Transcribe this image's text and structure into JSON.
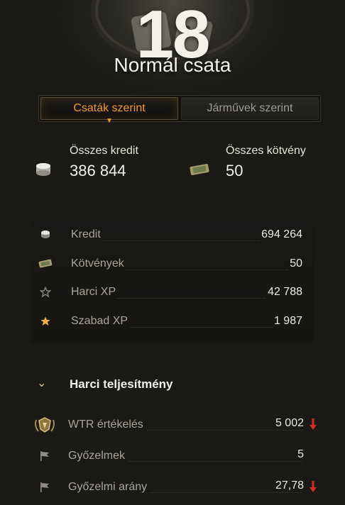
{
  "header": {
    "battles_count": "18",
    "mode_title": "Normál csata"
  },
  "tabs": [
    {
      "label": "Csaták szerint",
      "active": true
    },
    {
      "label": "Járművek szerint",
      "active": false
    }
  ],
  "summary": {
    "credits_label": "Összes kredit",
    "credits_value": "386 844",
    "bonds_label": "Összes kötvény",
    "bonds_value": "50"
  },
  "details": [
    {
      "icon": "coins-icon",
      "label": "Kredit",
      "value": "694 264"
    },
    {
      "icon": "bonds-icon",
      "label": "Kötvények",
      "value": "50"
    },
    {
      "icon": "star-outline-icon",
      "label": "Harci XP",
      "value": "42 788"
    },
    {
      "icon": "star-gold-icon",
      "label": "Szabad XP",
      "value": "1 987"
    }
  ],
  "performance": {
    "title": "Harci teljesítmény",
    "rows": [
      {
        "icon": "wtr-badge-icon",
        "label": "WTR értékelés",
        "value": "5 002",
        "trend": "down"
      },
      {
        "icon": "flag-icon",
        "label": "Győzelmek",
        "value": "5",
        "trend": ""
      },
      {
        "icon": "flag-icon",
        "label": "Győzelmi arány",
        "value": "27,78",
        "trend": "down"
      }
    ]
  },
  "colors": {
    "accent": "#f29a2e",
    "trend_down": "#d42a1f",
    "background": "#1b1a16"
  }
}
